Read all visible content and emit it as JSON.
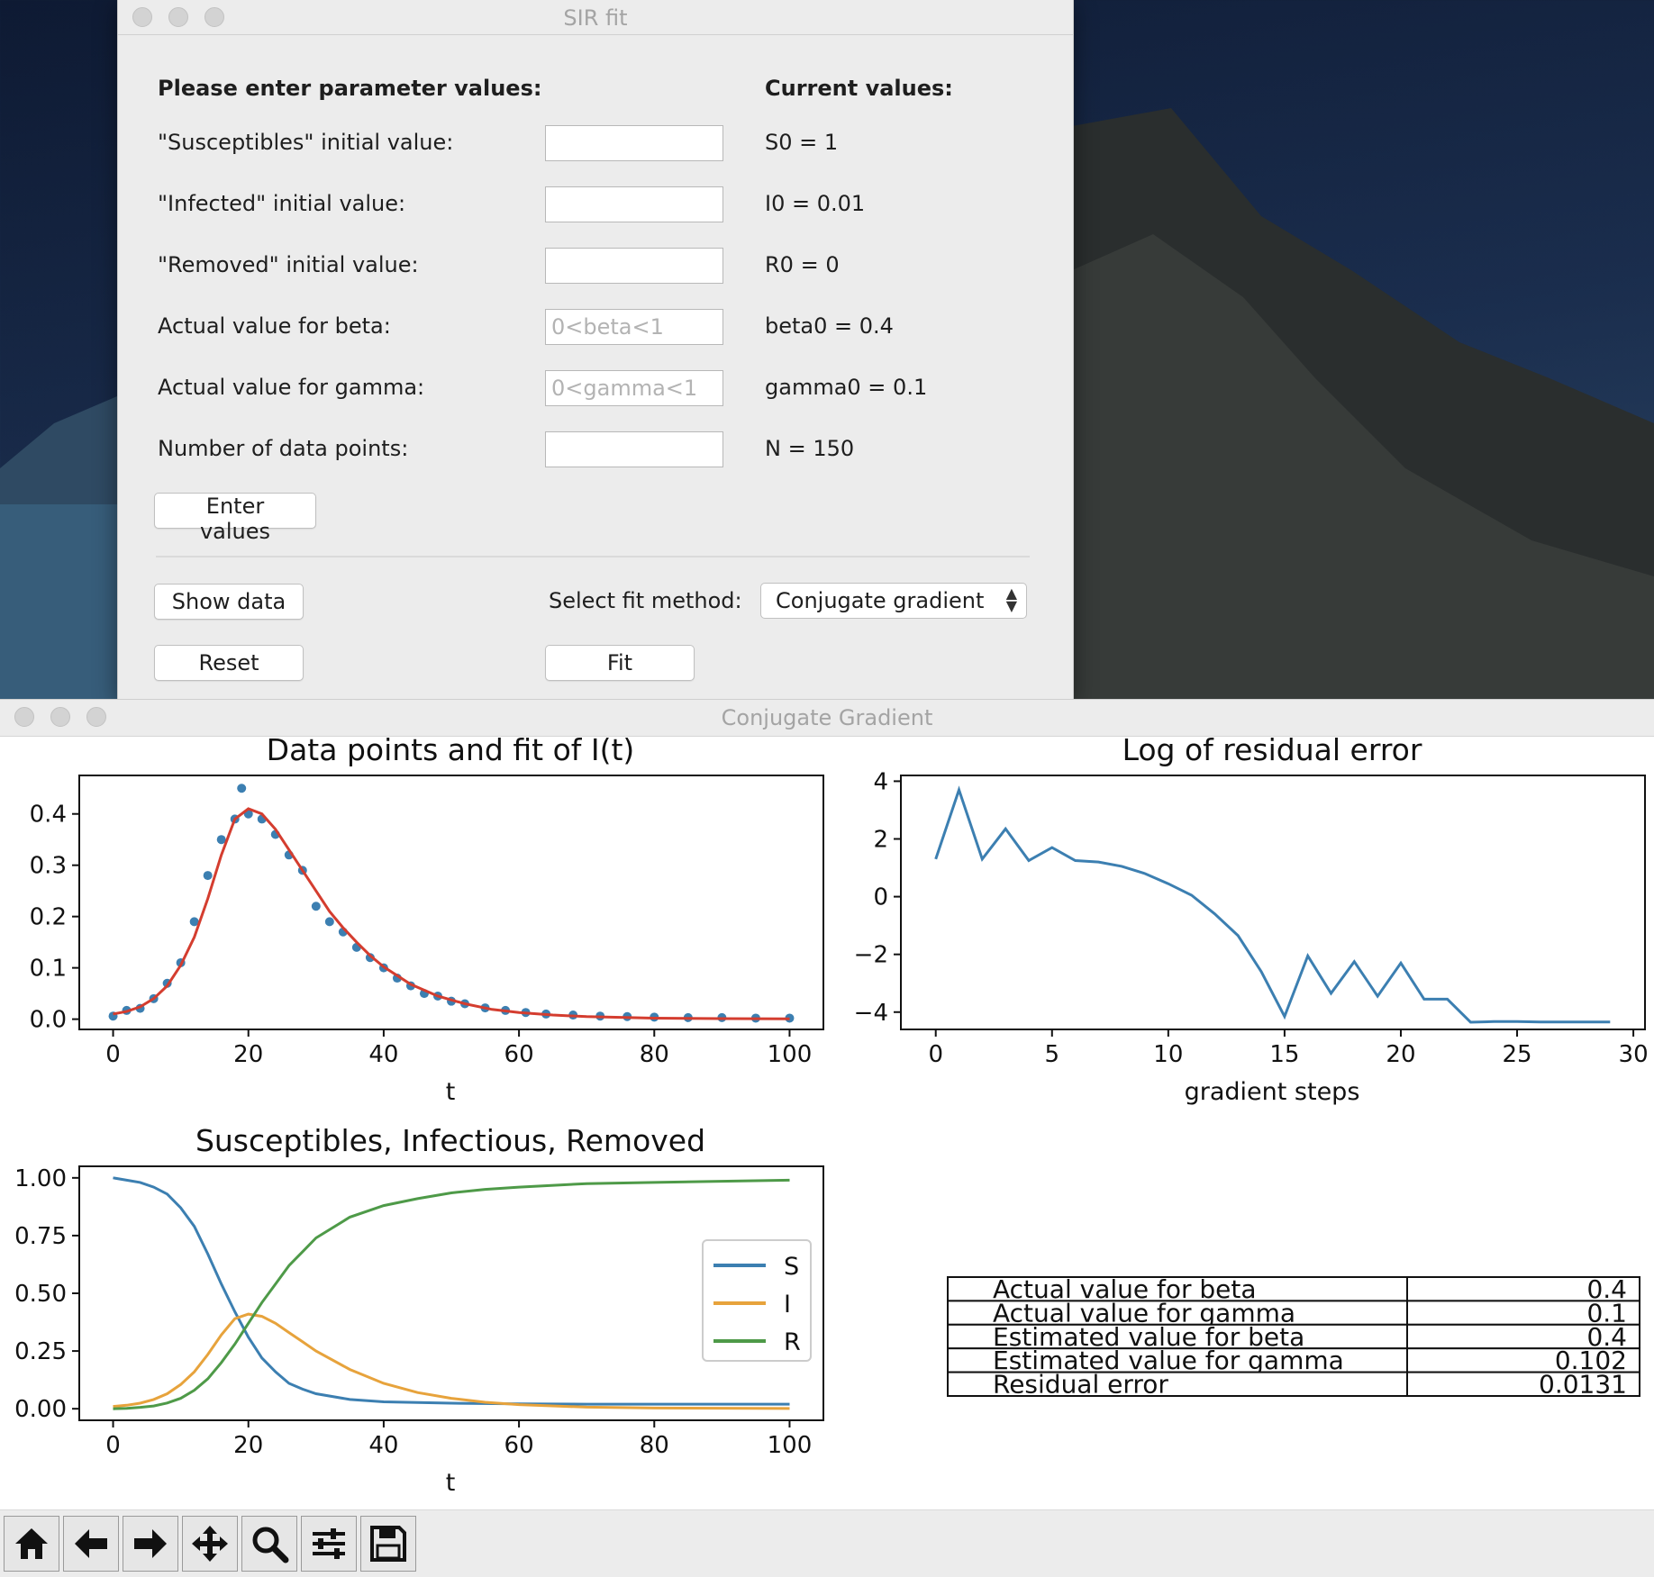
{
  "sir_window": {
    "title": "SIR fit",
    "params_header": "Please enter parameter values:",
    "current_header": "Current values:",
    "rows": [
      {
        "label": "\"Susceptibles\" initial value:",
        "placeholder": "",
        "current": "S0 = 1"
      },
      {
        "label": "\"Infected\" initial value:",
        "placeholder": "",
        "current": "I0 = 0.01"
      },
      {
        "label": "\"Removed\" initial value:",
        "placeholder": "",
        "current": "R0 = 0"
      },
      {
        "label": "Actual value for beta:",
        "placeholder": "0<beta<1",
        "current": "beta0 = 0.4"
      },
      {
        "label": "Actual value for gamma:",
        "placeholder": "0<gamma<1",
        "current": "gamma0 = 0.1"
      },
      {
        "label": "Number of data points:",
        "placeholder": "",
        "current": "N = 150"
      }
    ],
    "enter_button": "Enter values",
    "show_data_button": "Show data",
    "reset_button": "Reset",
    "fit_button": "Fit",
    "fit_method_label": "Select fit method:",
    "fit_method_value": "Conjugate gradient"
  },
  "cg_window": {
    "title": "Conjugate Gradient",
    "toolbar": [
      "home-icon",
      "back-arrow-icon",
      "forward-arrow-icon",
      "pan-icon",
      "zoom-icon",
      "configure-subplots-icon",
      "save-icon"
    ]
  },
  "chart_data": [
    {
      "type": "scatter",
      "title": "Data points and fit of I(t)",
      "xlabel": "t",
      "ylabel": "",
      "xlim": [
        -5,
        105
      ],
      "ylim": [
        -0.02,
        0.475
      ],
      "xticks": [
        0,
        20,
        40,
        60,
        80,
        100
      ],
      "yticks": [
        0.0,
        0.1,
        0.2,
        0.3,
        0.4
      ],
      "ytick_labels": [
        "0.0",
        "0.1",
        "0.2",
        "0.3",
        "0.4"
      ],
      "series": [
        {
          "kind": "points",
          "color": "#3c7fb1",
          "x": [
            0,
            2,
            4,
            6,
            8,
            10,
            12,
            14,
            16,
            18,
            19,
            20,
            22,
            24,
            26,
            28,
            30,
            32,
            34,
            36,
            38,
            40,
            42,
            44,
            46,
            48,
            50,
            52,
            55,
            58,
            61,
            64,
            68,
            72,
            76,
            80,
            85,
            90,
            95,
            100
          ],
          "y": [
            0.006,
            0.017,
            0.021,
            0.04,
            0.07,
            0.11,
            0.19,
            0.28,
            0.35,
            0.39,
            0.45,
            0.4,
            0.39,
            0.36,
            0.32,
            0.29,
            0.22,
            0.19,
            0.17,
            0.14,
            0.12,
            0.1,
            0.08,
            0.065,
            0.05,
            0.045,
            0.035,
            0.03,
            0.022,
            0.017,
            0.013,
            0.01,
            0.008,
            0.006,
            0.005,
            0.004,
            0.003,
            0.003,
            0.002,
            0.002
          ]
        },
        {
          "kind": "line",
          "color": "#d43d2f",
          "x": [
            0,
            2,
            4,
            6,
            8,
            10,
            12,
            14,
            16,
            18,
            20,
            22,
            24,
            26,
            28,
            30,
            32,
            34,
            36,
            38,
            40,
            44,
            48,
            52,
            56,
            60,
            65,
            70,
            80,
            90,
            100
          ],
          "y": [
            0.01,
            0.015,
            0.024,
            0.04,
            0.065,
            0.105,
            0.16,
            0.235,
            0.32,
            0.39,
            0.41,
            0.4,
            0.37,
            0.33,
            0.29,
            0.25,
            0.21,
            0.178,
            0.15,
            0.124,
            0.102,
            0.068,
            0.045,
            0.03,
            0.019,
            0.013,
            0.008,
            0.005,
            0.002,
            0.001,
            0.0005
          ]
        }
      ]
    },
    {
      "type": "line",
      "title": "Log of residual error",
      "xlabel": "gradient steps",
      "ylabel": "",
      "xlim": [
        -1.5,
        30.5
      ],
      "ylim": [
        -4.6,
        4.2
      ],
      "xticks": [
        0,
        5,
        10,
        15,
        20,
        25,
        30
      ],
      "yticks": [
        -4,
        -2,
        0,
        2,
        4
      ],
      "ytick_labels": [
        "−4",
        "−2",
        "0",
        "2",
        "4"
      ],
      "series": [
        {
          "color": "#3c7fb1",
          "x": [
            0,
            1,
            2,
            3,
            4,
            5,
            6,
            7,
            8,
            9,
            10,
            11,
            12,
            13,
            14,
            15,
            16,
            17,
            18,
            19,
            20,
            21,
            22,
            23,
            24,
            25,
            26,
            27,
            28,
            29
          ],
          "y": [
            1.3,
            3.7,
            1.3,
            2.35,
            1.25,
            1.7,
            1.25,
            1.2,
            1.05,
            0.8,
            0.45,
            0.05,
            -0.6,
            -1.35,
            -2.6,
            -4.15,
            -2.05,
            -3.35,
            -2.25,
            -3.45,
            -2.3,
            -3.55,
            -3.55,
            -4.35,
            -4.33,
            -4.33,
            -4.34,
            -4.34,
            -4.34,
            -4.34
          ]
        }
      ]
    },
    {
      "type": "line",
      "title": "Susceptibles, Infectious, Removed",
      "xlabel": "t",
      "ylabel": "",
      "xlim": [
        -5,
        105
      ],
      "ylim": [
        -0.05,
        1.05
      ],
      "xticks": [
        0,
        20,
        40,
        60,
        80,
        100
      ],
      "yticks": [
        0.0,
        0.25,
        0.5,
        0.75,
        1.0
      ],
      "ytick_labels": [
        "0.00",
        "0.25",
        "0.50",
        "0.75",
        "1.00"
      ],
      "legend": "right",
      "series": [
        {
          "name": "S",
          "color": "#3c7fb1",
          "x": [
            0,
            2,
            4,
            6,
            8,
            10,
            12,
            14,
            16,
            18,
            20,
            22,
            24,
            26,
            28,
            30,
            35,
            40,
            50,
            60,
            70,
            80,
            100
          ],
          "y": [
            1.0,
            0.99,
            0.98,
            0.96,
            0.93,
            0.87,
            0.79,
            0.67,
            0.54,
            0.42,
            0.31,
            0.22,
            0.16,
            0.11,
            0.085,
            0.065,
            0.04,
            0.03,
            0.024,
            0.021,
            0.02,
            0.02,
            0.02
          ]
        },
        {
          "name": "I",
          "color": "#e7a33c",
          "x": [
            0,
            2,
            4,
            6,
            8,
            10,
            12,
            14,
            16,
            18,
            20,
            22,
            24,
            26,
            28,
            30,
            35,
            40,
            45,
            50,
            55,
            60,
            70,
            80,
            100
          ],
          "y": [
            0.01,
            0.015,
            0.024,
            0.04,
            0.065,
            0.105,
            0.16,
            0.235,
            0.32,
            0.39,
            0.41,
            0.4,
            0.37,
            0.33,
            0.29,
            0.25,
            0.17,
            0.11,
            0.07,
            0.045,
            0.028,
            0.018,
            0.007,
            0.003,
            0.001
          ]
        },
        {
          "name": "R",
          "color": "#4e9a48",
          "x": [
            0,
            2,
            4,
            6,
            8,
            10,
            12,
            14,
            16,
            18,
            20,
            22,
            24,
            26,
            28,
            30,
            35,
            40,
            45,
            50,
            55,
            60,
            70,
            80,
            100
          ],
          "y": [
            0.0,
            0.002,
            0.006,
            0.012,
            0.025,
            0.045,
            0.08,
            0.13,
            0.2,
            0.28,
            0.37,
            0.46,
            0.54,
            0.62,
            0.68,
            0.74,
            0.83,
            0.88,
            0.91,
            0.935,
            0.95,
            0.96,
            0.975,
            0.98,
            0.99
          ]
        }
      ]
    },
    {
      "type": "table",
      "rows": [
        [
          "Actual value for beta",
          "0.4"
        ],
        [
          "Actual value for gamma",
          "0.1"
        ],
        [
          "Estimated value for beta",
          "0.4"
        ],
        [
          "Estimated value for gamma",
          "0.102"
        ],
        [
          "Residual error",
          "0.0131"
        ]
      ]
    }
  ]
}
